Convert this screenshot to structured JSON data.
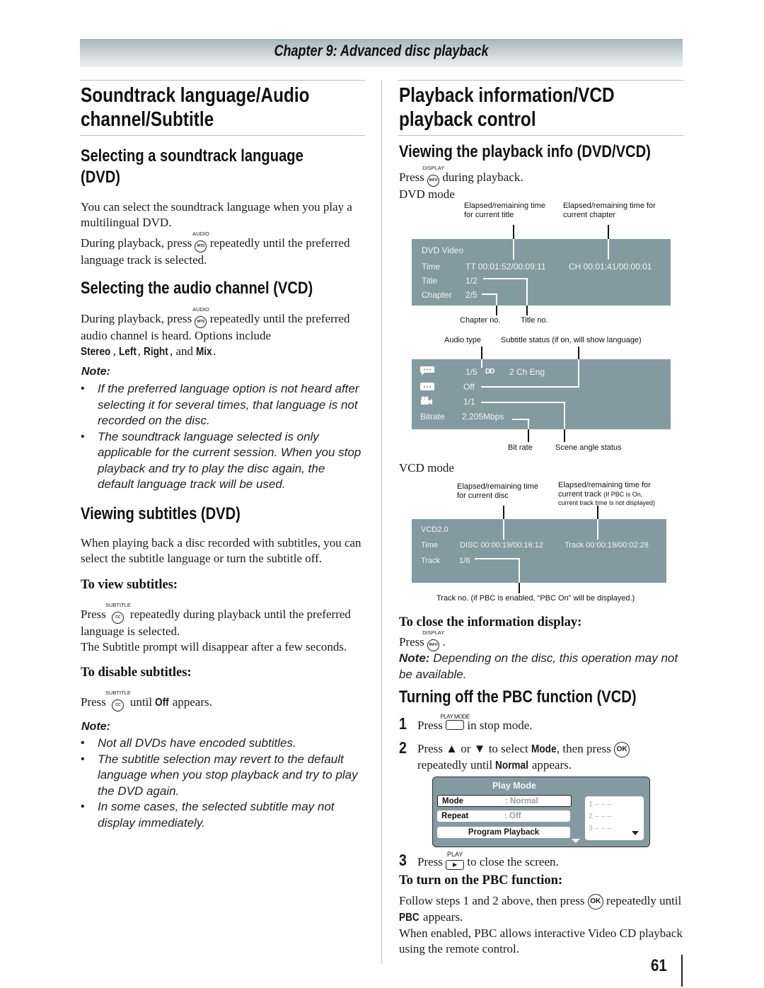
{
  "header": {
    "chapter": "Chapter 9: Advanced disc playback"
  },
  "left": {
    "title": "Soundtrack language/Audio channel/Subtitle",
    "title_line1": "Soundtrack language/Audio",
    "title_line2": "channel/Subtitle",
    "soundtrack": {
      "heading_line1": "Selecting a soundtrack language",
      "heading_line2": "(DVD)",
      "para1": "You can select the soundtrack language when you play a multilingual DVD.",
      "para2_pre": "During playback, press",
      "para2_post": "repeatedly until the preferred language track is selected.",
      "button_caption": "AUDIO",
      "button_label": "MTS"
    },
    "audio_channel": {
      "heading": "Selecting the audio channel (VCD)",
      "para_pre": "During playback, press",
      "para_post": "repeatedly until the preferred audio channel is heard. Options include",
      "options": [
        "Stereo",
        "Left",
        "Right",
        "Mix"
      ],
      "sep1": ", ",
      "sep2": ", ",
      "sep3": ", and ",
      "end": ".",
      "button_caption": "AUDIO",
      "button_label": "MTS"
    },
    "note1": {
      "label": "Note:",
      "items": [
        "If the preferred language option is not heard after selecting it for several times, that language is not recorded on the disc.",
        "The soundtrack language selected is only applicable for the current session. When you stop playback and try to play the disc again, the default language track will be used."
      ]
    },
    "subtitles": {
      "heading": "Viewing subtitles (DVD)",
      "para": "When playing back a disc recorded with subtitles, you can select the subtitle language or turn the subtitle off.",
      "view_heading": "To view subtitles:",
      "view_pre": "Press",
      "view_post": "repeatedly during playback until the preferred language is selected.",
      "view_para2": "The Subtitle prompt will disappear after a few seconds.",
      "disable_heading": "To disable subtitles:",
      "disable_pre": "Press",
      "disable_mid": "until",
      "disable_value": "Off",
      "disable_post": "appears.",
      "button_caption": "SUBTITLE",
      "button_label": "CC"
    },
    "note2": {
      "label": "Note:",
      "items": [
        "Not all DVDs have encoded subtitles.",
        "The subtitle selection may revert to the default language when you stop playback and try to play the DVD again.",
        "In some cases, the selected subtitle may not display immediately."
      ]
    }
  },
  "right": {
    "title_line1": "Playback information/VCD",
    "title_line2": "playback control",
    "info": {
      "heading": "Viewing the playback info (DVD/VCD)",
      "press": "Press",
      "press_post": "during playback.",
      "button_caption": "DISPLAY",
      "button_label": "INFO",
      "dvd_mode": "DVD mode"
    },
    "dvd_screen1": {
      "callout_title_time": "Elapsed/remaining time\nfor current title",
      "callout_chapter_time": "Elapsed/remaining time for\ncurrent chapter",
      "header": "DVD  Video",
      "rows": [
        {
          "label": "Time",
          "value": "TT 00:01:52/00:09:11",
          "extra": "CH  00:01:41/00:00:01"
        },
        {
          "label": "Title",
          "value": "1/2"
        },
        {
          "label": "Chapter",
          "value": "2/5"
        }
      ],
      "callout_chapter_no": "Chapter no.",
      "callout_title_no": "Title no."
    },
    "dvd_screen2": {
      "callout_audio_type": "Audio type",
      "callout_subtitle_status": "Subtitle status (if on, will show language)",
      "rows": [
        {
          "icon": "audio-icon",
          "value": "1/5",
          "extra": "2 Ch Eng",
          "badge": "DD"
        },
        {
          "icon": "subtitle-icon",
          "value": "Off"
        },
        {
          "icon": "camera-angle-icon",
          "value": "1/1"
        },
        {
          "label": "Bitrate",
          "value": "2.205Mbps"
        }
      ],
      "callout_bit_rate": "Bit rate",
      "callout_scene_angle": "Scene angle status"
    },
    "vcd_mode": "VCD mode",
    "vcd_screen": {
      "callout_disc_time": "Elapsed/remaining time\nfor current disc",
      "callout_track_time_main": "Elapsed/remaining time for",
      "callout_track_time_line2": "current track",
      "callout_track_time_small": "(If PBC is On,",
      "callout_track_time_small2": "current track time is not displayed)",
      "header": "VCD2.0",
      "rows": [
        {
          "label": "Time",
          "value": "DISC 00:00:19/00:16:12",
          "extra": "Track  00:00:19/00:02:28"
        },
        {
          "label": "Track",
          "value": "1/8"
        }
      ],
      "callout_track_no": "Track no. (if PBC is enabled, “PBC On” will be displayed.)"
    },
    "close_info": {
      "heading": "To close the information display:",
      "press": "Press",
      "end": ".",
      "button_caption": "DISPLAY",
      "button_label": "INFO",
      "note_label": "Note:",
      "note_text": "Depending on the disc, this operation may not be available."
    },
    "pbc": {
      "heading": "Turning off the PBC function (VCD)",
      "step1_num": "1",
      "step1_pre": "Press",
      "step1_button_caption": "PLAY MODE",
      "step1_post": "in stop mode.",
      "step2_num": "2",
      "step2_text_a": "Press ▲ or ▼ to select",
      "step2_bold1": "Mode",
      "step2_text_b": ", then press",
      "step2_text_c": "repeatedly until",
      "step2_bold2": "Normal",
      "step2_text_d": "appears.",
      "ok_label": "OK",
      "play_mode_panel": {
        "title": "Play Mode",
        "rows": [
          {
            "label": "Mode",
            "value": ": Normal"
          },
          {
            "label": "Repeat",
            "value": ": Off"
          }
        ],
        "program_button": "Program Playback",
        "program_list": [
          "1   – – –",
          "2   – – –",
          "3   – – –"
        ]
      },
      "step3_num": "3",
      "step3_pre": "Press",
      "step3_button_caption": "PLAY",
      "step3_post": "to close the screen.",
      "turn_on_heading": "To turn on the PBC function:",
      "turn_on_pre": "Follow steps 1 and 2 above, then press",
      "turn_on_mid": "repeatedly until",
      "turn_on_bold": "PBC",
      "turn_on_post": "appears.",
      "turn_on_para2": "When enabled, PBC allows interactive Video CD playback using the remote control."
    }
  },
  "footer": {
    "page_number": "61"
  }
}
